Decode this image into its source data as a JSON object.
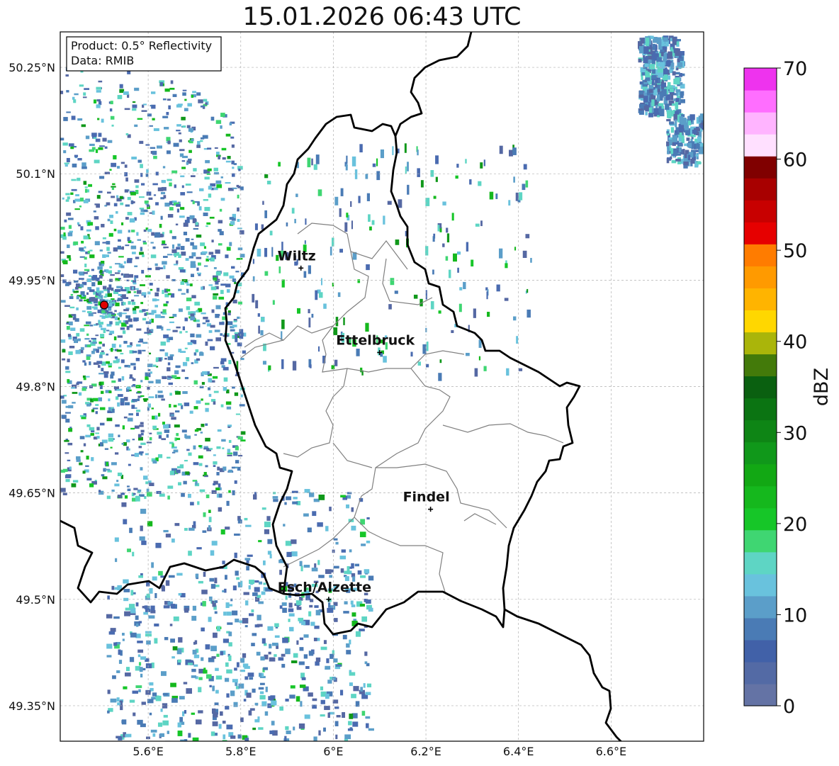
{
  "title": "15.01.2026 06:43 UTC",
  "info_box": {
    "product": "Product: 0.5° Reflectivity",
    "data": "Data: RMIB"
  },
  "map": {
    "lon_range": [
      5.41,
      6.8
    ],
    "lat_range": [
      49.3,
      50.3
    ],
    "lon_ticks": [
      {
        "value": 5.6,
        "label": "5.6°E"
      },
      {
        "value": 5.8,
        "label": "5.8°E"
      },
      {
        "value": 6.0,
        "label": "6°E"
      },
      {
        "value": 6.2,
        "label": "6.2°E"
      },
      {
        "value": 6.4,
        "label": "6.4°E"
      },
      {
        "value": 6.6,
        "label": "6.6°E"
      }
    ],
    "lat_ticks": [
      {
        "value": 50.25,
        "label": "50.25°N"
      },
      {
        "value": 50.1,
        "label": "50.1°N"
      },
      {
        "value": 49.95,
        "label": "49.95°N"
      },
      {
        "value": 49.8,
        "label": "49.8°N"
      },
      {
        "value": 49.65,
        "label": "49.65°N"
      },
      {
        "value": 49.5,
        "label": "49.5°N"
      },
      {
        "value": 49.35,
        "label": "49.35°N"
      }
    ],
    "grid": true,
    "radar_site": {
      "lon": 5.505,
      "lat": 49.915,
      "color": "#e00000"
    },
    "cities": [
      {
        "name": "Wiltz",
        "lon": 5.93,
        "lat": 49.967
      },
      {
        "name": "Ettelbruck",
        "lon": 6.1,
        "lat": 49.848
      },
      {
        "name": "Findel",
        "lon": 6.21,
        "lat": 49.627
      },
      {
        "name": "Esch/Alzette",
        "lon": 5.99,
        "lat": 49.5
      }
    ]
  },
  "colorbar": {
    "label": "dBZ",
    "min": 0,
    "max": 70,
    "ticks": [
      {
        "value": 0,
        "label": "0"
      },
      {
        "value": 10,
        "label": "10"
      },
      {
        "value": 20,
        "label": "20"
      },
      {
        "value": 30,
        "label": "30"
      },
      {
        "value": 40,
        "label": "40"
      },
      {
        "value": 50,
        "label": "50"
      },
      {
        "value": 60,
        "label": "60"
      },
      {
        "value": 70,
        "label": "70"
      }
    ],
    "colors": [
      "#6473a5",
      "#536aa5",
      "#4161a8",
      "#4a7bb5",
      "#5b9ec9",
      "#69c2dd",
      "#5ed5c4",
      "#3fd672",
      "#16c628",
      "#15b81d",
      "#12a814",
      "#10981a",
      "#0e8515",
      "#0b7412",
      "#0a6010",
      "#437a0a",
      "#aab50a",
      "#ffd700",
      "#ffb400",
      "#ff9a00",
      "#ff7c00",
      "#e60000",
      "#c80000",
      "#a80000",
      "#800000",
      "#ffe0ff",
      "#ffb4ff",
      "#ff6eff",
      "#ee33ee"
    ]
  }
}
